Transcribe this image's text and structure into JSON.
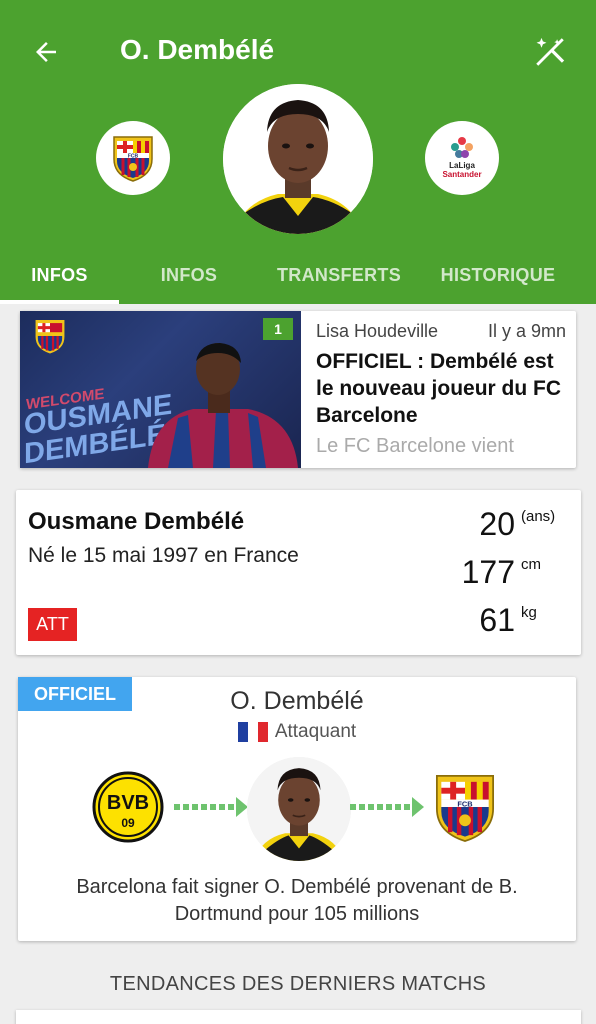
{
  "header": {
    "title": "O. Dembélé",
    "back_icon": "arrow-left-icon",
    "action_icon": "magic-wand-off-icon",
    "accent": "#4ca22f",
    "club_crest_text": "FCB",
    "league": {
      "line1": "LaLiga",
      "line2": "Santander"
    }
  },
  "tabs": [
    {
      "label": "INFOS",
      "active": true
    },
    {
      "label": "INFOS",
      "active": false
    },
    {
      "label": "TRANSFERTS",
      "active": false
    },
    {
      "label": "HISTORIQUE",
      "active": false
    }
  ],
  "news": {
    "count": "1",
    "author": "Lisa Houdeville",
    "time": "Il y a 9mn",
    "title": "OFFICIEL : Dembélé est le nouveau joueur du FC Barcelone",
    "excerpt": "Le FC Barcelone vient",
    "image_text": {
      "welcome": "WELCOME",
      "first": "OUSMANE",
      "last": "DEMBÉLÉ"
    }
  },
  "player": {
    "name": "Ousmane Dembélé",
    "born": "Né le 15 mai 1997 en France",
    "position_badge": "ATT",
    "age": "20",
    "age_unit": "(ans)",
    "height": "177",
    "height_unit": "cm",
    "weight": "61",
    "weight_unit": "kg"
  },
  "transfer": {
    "tag": "OFFICIEL",
    "name": "O. Dembélé",
    "position": "Attaquant",
    "from_club_text": "BVB",
    "from_club_number": "09",
    "to_club_text": "FCB",
    "description": "Barcelona fait signer O. Dembélé provenant de B. Dortmund pour 105 millions",
    "tag_color": "#42a5ef"
  },
  "section": {
    "title": "TENDANCES DES DERNIERS MATCHS"
  }
}
